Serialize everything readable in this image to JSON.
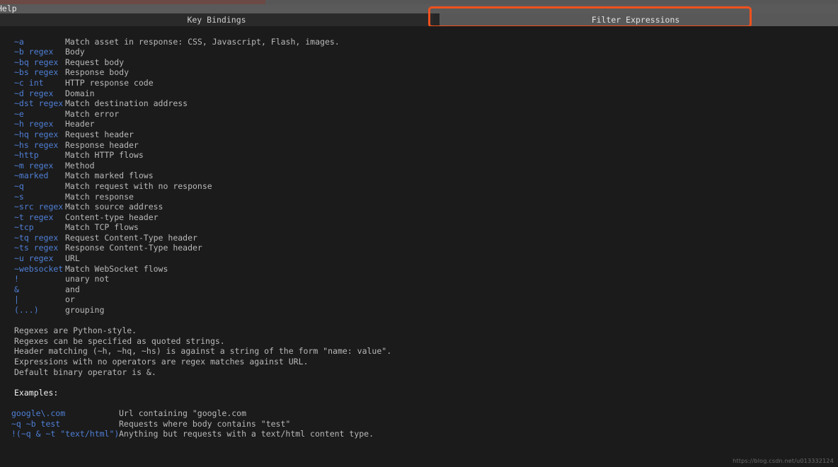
{
  "window": {
    "title": "Help"
  },
  "tabs": [
    {
      "id": "key-bindings",
      "label": "Key Bindings",
      "active": false
    },
    {
      "id": "filter-expressions",
      "label": "Filter Expressions",
      "active": true
    }
  ],
  "highlight": {
    "target_tab": "filter-expressions",
    "color": "#f0511e"
  },
  "colors": {
    "background": "#1b1b1b",
    "header_bar": "#5a5a5a",
    "tab_inactive": "#2a2a2a",
    "tab_active": "#585858",
    "key_text": "#4f7fd6",
    "body_text": "#b9b9b9",
    "title_text": "#f0f0f0",
    "accent": "#f0511e"
  },
  "filters": [
    {
      "key": "~a",
      "desc": "Match asset in response: CSS, Javascript, Flash, images."
    },
    {
      "key": "~b regex",
      "desc": "Body"
    },
    {
      "key": "~bq regex",
      "desc": "Request body"
    },
    {
      "key": "~bs regex",
      "desc": "Response body"
    },
    {
      "key": "~c int",
      "desc": "HTTP response code"
    },
    {
      "key": "~d regex",
      "desc": "Domain"
    },
    {
      "key": "~dst regex",
      "desc": "Match destination address"
    },
    {
      "key": "~e",
      "desc": "Match error"
    },
    {
      "key": "~h regex",
      "desc": "Header"
    },
    {
      "key": "~hq regex",
      "desc": "Request header"
    },
    {
      "key": "~hs regex",
      "desc": "Response header"
    },
    {
      "key": "~http",
      "desc": "Match HTTP flows"
    },
    {
      "key": "~m regex",
      "desc": "Method"
    },
    {
      "key": "~marked",
      "desc": "Match marked flows"
    },
    {
      "key": "~q",
      "desc": "Match request with no response"
    },
    {
      "key": "~s",
      "desc": "Match response"
    },
    {
      "key": "~src regex",
      "desc": "Match source address"
    },
    {
      "key": "~t regex",
      "desc": "Content-type header"
    },
    {
      "key": "~tcp",
      "desc": "Match TCP flows"
    },
    {
      "key": "~tq regex",
      "desc": "Request Content-Type header"
    },
    {
      "key": "~ts regex",
      "desc": "Response Content-Type header"
    },
    {
      "key": "~u regex",
      "desc": "URL"
    },
    {
      "key": "~websocket",
      "desc": "Match WebSocket flows"
    },
    {
      "key": "!",
      "desc": "unary not"
    },
    {
      "key": "&",
      "desc": "and"
    },
    {
      "key": "|",
      "desc": "or"
    },
    {
      "key": "(...)",
      "desc": "grouping"
    }
  ],
  "notes": [
    "Regexes are Python-style.",
    "Regexes can be specified as quoted strings.",
    "Header matching (~h, ~hq, ~hs) is against a string of the form \"name: value\".",
    "Expressions with no operators are regex matches against URL.",
    "Default binary operator is &."
  ],
  "examples_heading": "Examples:",
  "examples": [
    {
      "expr": "google\\.com",
      "desc": "Url containing \"google.com"
    },
    {
      "expr": "~q ~b test",
      "desc": "Requests where body contains \"test\""
    },
    {
      "expr": "!(~q & ~t \"text/html\")",
      "desc": "Anything but requests with a text/html content type."
    }
  ],
  "watermark": "https://blog.csdn.net/u013332124"
}
